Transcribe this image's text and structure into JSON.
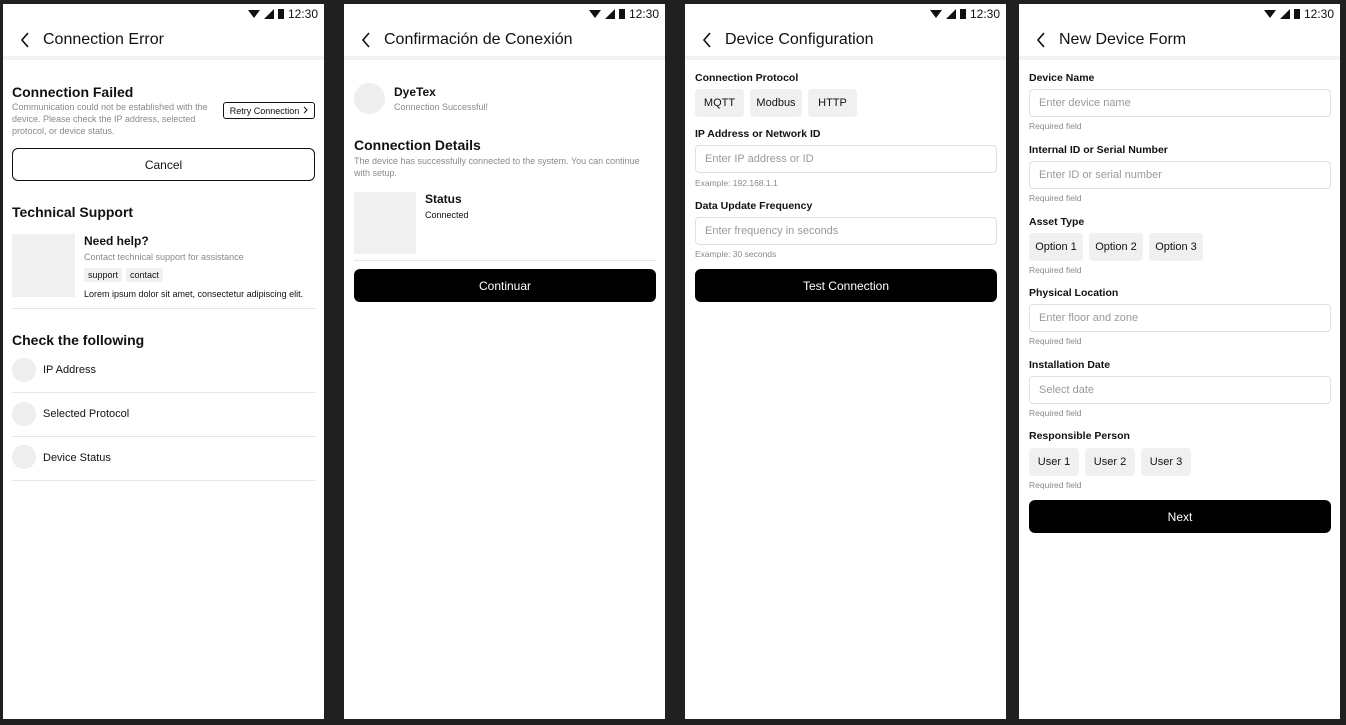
{
  "status_bar": {
    "time": "12:30"
  },
  "screen1": {
    "title": "Connection Error",
    "failed_title": "Connection Failed",
    "failed_desc": "Communication could not be established with the device. Please check the IP address, selected protocol, or device status.",
    "retry_label": "Retry Connection",
    "cancel_label": "Cancel",
    "support_title": "Technical Support",
    "help_title": "Need help?",
    "help_desc": "Contact technical support for assistance",
    "tags": [
      "support",
      "contact"
    ],
    "lorem": "Lorem ipsum dolor sit amet, consectetur adipiscing elit.",
    "check_title": "Check the following",
    "checks": [
      "IP Address",
      "Selected Protocol",
      "Device Status"
    ]
  },
  "screen2": {
    "title": "Confirmación de Conexión",
    "device_name": "DyeTex",
    "device_status": "Connection Successful!",
    "details_title": "Connection Details",
    "details_desc": "The device has successfully connected to the system. You can continue with setup.",
    "status_label": "Status",
    "status_value": "Connected",
    "continue_label": "Continuar"
  },
  "screen3": {
    "title": "Device Configuration",
    "protocol_label": "Connection Protocol",
    "protocols": [
      "MQTT",
      "Modbus",
      "HTTP"
    ],
    "ip_label": "IP Address or Network ID",
    "ip_placeholder": "Enter IP address or ID",
    "ip_hint": "Example: 192.168.1.1",
    "freq_label": "Data Update Frequency",
    "freq_placeholder": "Enter frequency in seconds",
    "freq_hint": "Example: 30 seconds",
    "test_label": "Test Connection"
  },
  "screen4": {
    "title": "New Device Form",
    "name_label": "Device Name",
    "name_placeholder": "Enter device name",
    "required": "Required field",
    "serial_label": "Internal ID or Serial Number",
    "serial_placeholder": "Enter ID or serial number",
    "asset_label": "Asset Type",
    "asset_options": [
      "Option 1",
      "Option 2",
      "Option 3"
    ],
    "location_label": "Physical Location",
    "location_placeholder": "Enter floor and zone",
    "date_label": "Installation Date",
    "date_placeholder": "Select date",
    "person_label": "Responsible Person",
    "person_options": [
      "User 1",
      "User 2",
      "User 3"
    ],
    "next_label": "Next"
  }
}
